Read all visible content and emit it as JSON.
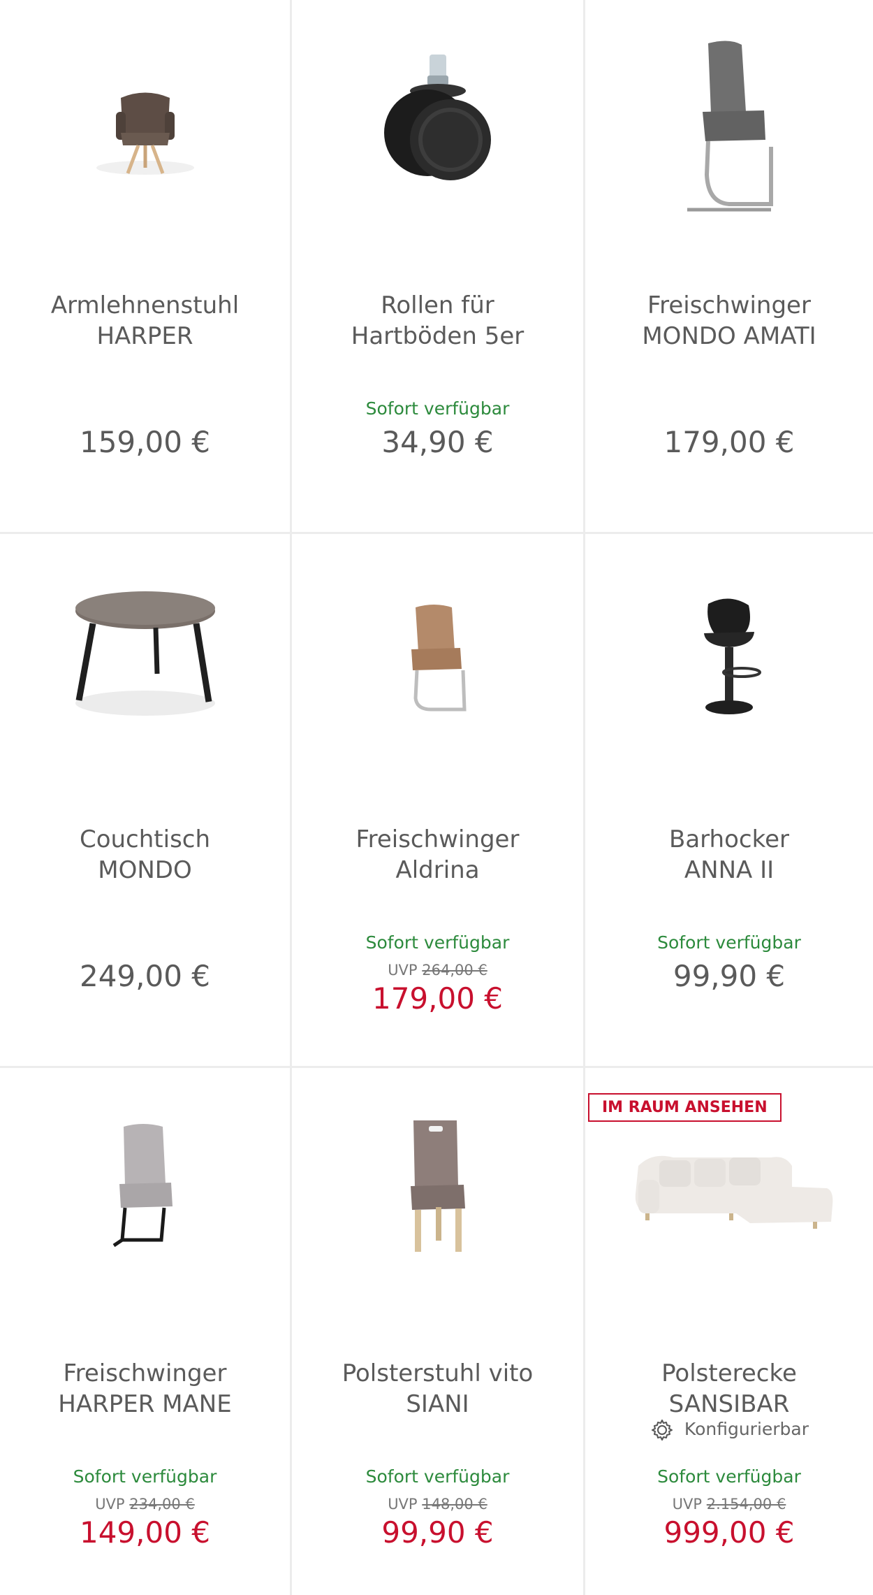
{
  "products": [
    {
      "name_line1": "Armlehnenstuhl",
      "name_line2": "HARPER",
      "price": "159,00 €"
    },
    {
      "name_line1": "Rollen für",
      "name_line2": "Hartböden 5er",
      "availability": "Sofort verfügbar",
      "price": "34,90 €"
    },
    {
      "name_line1": "Freischwinger",
      "name_line2": "MONDO AMATI",
      "price": "179,00 €"
    },
    {
      "name_line1": "Couchtisch",
      "name_line2": "MONDO",
      "price": "249,00 €"
    },
    {
      "name_line1": "Freischwinger",
      "name_line2": "Aldrina",
      "availability": "Sofort verfügbar",
      "uvp_label": "UVP",
      "uvp_price": "264,00 €",
      "price": "179,00 €"
    },
    {
      "name_line1": "Barhocker",
      "name_line2": "ANNA II",
      "availability": "Sofort verfügbar",
      "price": "99,90 €"
    },
    {
      "name_line1": "Freischwinger",
      "name_line2": "HARPER MANE",
      "availability": "Sofort verfügbar",
      "uvp_label": "UVP",
      "uvp_price": "234,00 €",
      "price": "149,00 €"
    },
    {
      "name_line1": "Polsterstuhl vito",
      "name_line2": "SIANI",
      "availability": "Sofort verfügbar",
      "uvp_label": "UVP",
      "uvp_price": "148,00 €",
      "price": "99,90 €"
    },
    {
      "badge": "IM RAUM ANSEHEN",
      "name_line1": "Polsterecke",
      "name_line2": "SANSIBAR",
      "configurable": "Konfigurierbar",
      "availability": "Sofort verfügbar",
      "uvp_label": "UVP",
      "uvp_price": "2.154,00 €",
      "price": "999,00 €"
    }
  ],
  "colors": {
    "availability_green": "#2c8a3c",
    "sale_red": "#c8102e",
    "text_gray": "#5a5a5a",
    "divider": "#ececec"
  }
}
